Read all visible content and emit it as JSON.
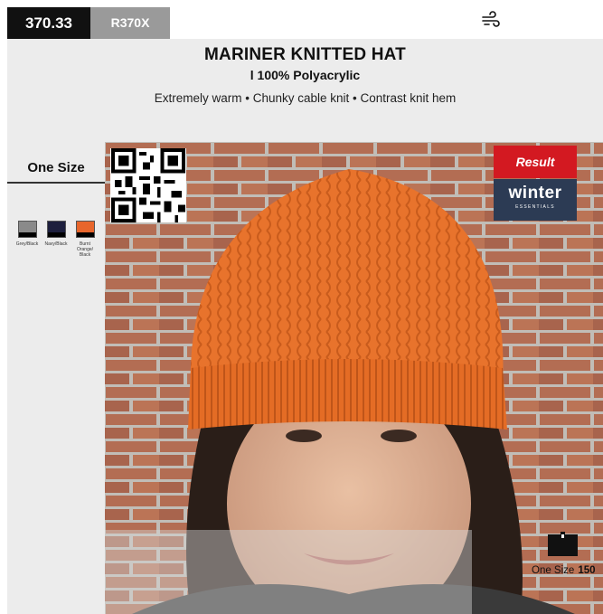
{
  "header": {
    "code": "370.33",
    "sku": "R370X",
    "wind_icon": "wind-icon"
  },
  "product": {
    "title": "MARINER KNITTED HAT",
    "subtitle": "l 100% Polyacrylic",
    "features": "Extremely warm • Chunky cable knit • Contrast knit hem"
  },
  "sidebar": {
    "size_label": "One Size",
    "swatches": [
      {
        "label": "Grey/Black",
        "color": "#8a8a8a"
      },
      {
        "label": "Navy/Black",
        "color": "#1d1f3d"
      },
      {
        "label": "Burnt Orange/ Black",
        "color": "#e8662c"
      }
    ]
  },
  "brand": {
    "result": "Result",
    "winter": "winter",
    "essentials": "ESSENTIALS"
  },
  "packing": {
    "size": "One Size",
    "count": "150",
    "icon": "box-icon"
  },
  "colors": {
    "hat": "#e8732c",
    "brick": "#a9593c"
  }
}
